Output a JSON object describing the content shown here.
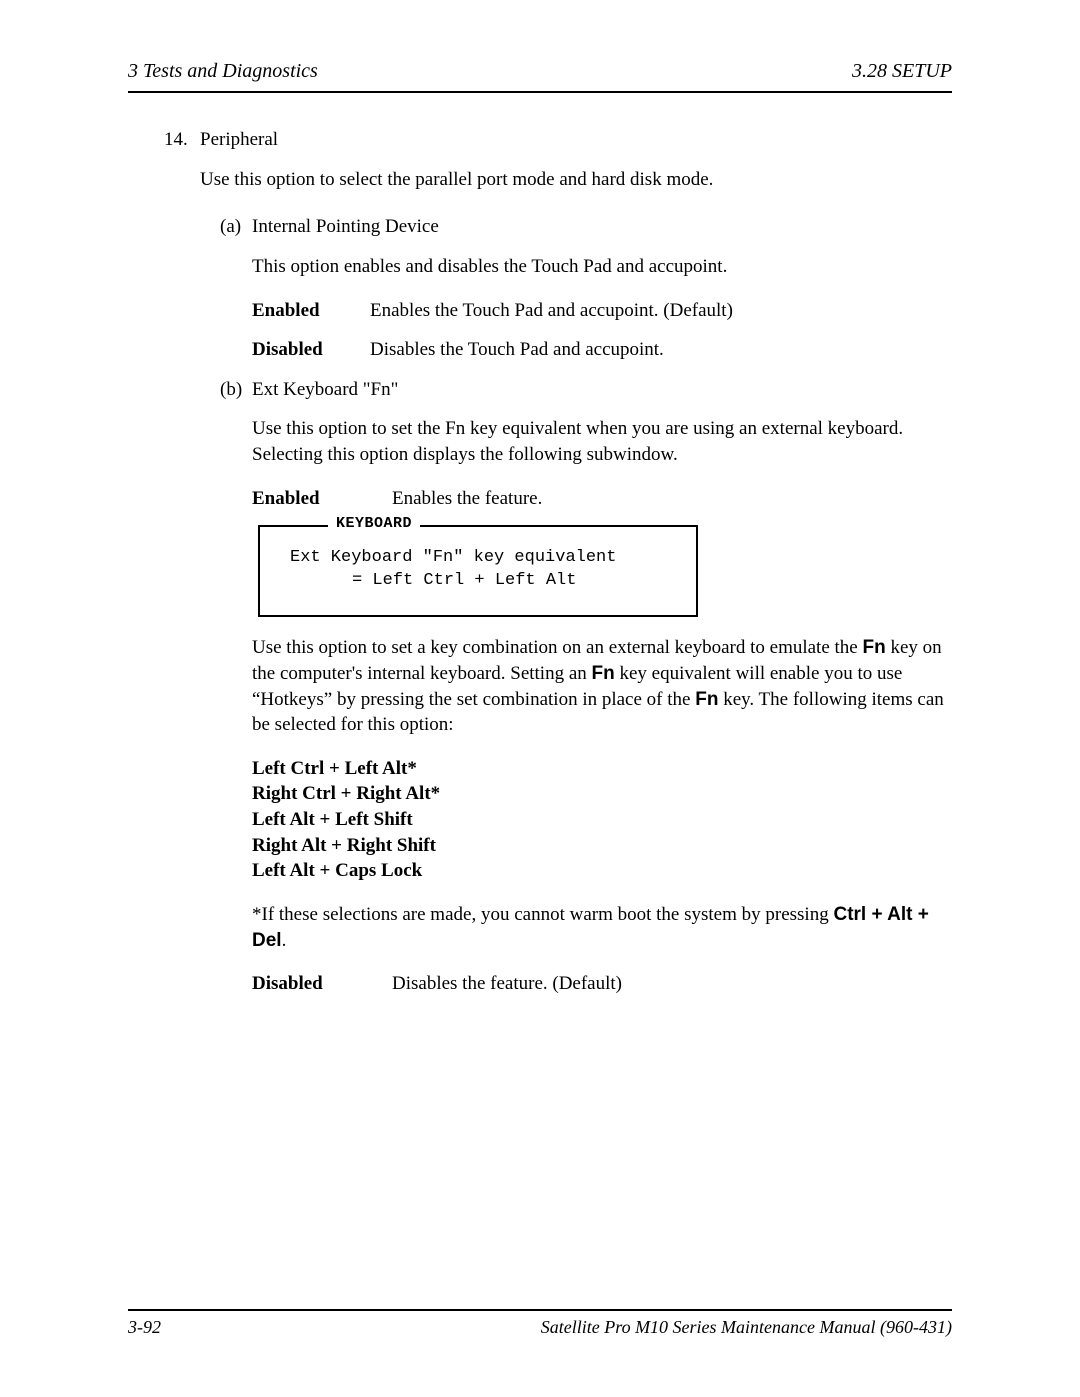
{
  "header": {
    "left": "3  Tests and Diagnostics",
    "right": "3.28  SETUP"
  },
  "section": {
    "number": "14.",
    "title": "Peripheral",
    "intro": "Use this option to select the parallel port mode and hard disk mode."
  },
  "subA": {
    "label": "(a)",
    "title": "Internal Pointing Device",
    "desc": "This option enables and disables the Touch Pad and accupoint.",
    "enabled_term": "Enabled",
    "enabled_desc": "Enables the Touch Pad and accupoint.  (Default)",
    "disabled_term": "Disabled",
    "disabled_desc": "Disables the Touch Pad and accupoint."
  },
  "subB": {
    "label": "(b)",
    "title": "Ext Keyboard \"Fn\"",
    "desc": "Use this option to set the Fn key equivalent when you are using an external keyboard. Selecting this option displays the following subwindow.",
    "enabled_term": "Enabled",
    "enabled_desc": "Enables the feature.",
    "box_title": "KEYBOARD",
    "box_line1": "Ext Keyboard \"Fn\" key equivalent",
    "box_line2": "= Left Ctrl + Left Alt",
    "para2_a": "Use this option to set a key combination on an external keyboard to emulate the ",
    "para2_fn1": "Fn",
    "para2_b": " key on the computer's internal keyboard. Setting an ",
    "para2_fn2": "Fn",
    "para2_c": " key equivalent will enable you to use “Hotkeys” by pressing the set combination in place of the ",
    "para2_fn3": "Fn",
    "para2_d": " key. The following items can be selected for this option:",
    "combos": [
      "Left Ctrl + Left Alt*",
      "Right Ctrl + Right Alt*",
      "Left Alt + Left Shift",
      "Right Alt + Right Shift",
      "Left Alt + Caps Lock"
    ],
    "note_a": "*If these selections are made, you cannot warm boot the system by pressing ",
    "note_b": "Ctrl + Alt + Del",
    "note_c": ".",
    "disabled_term": "Disabled",
    "disabled_desc": "Disables the feature. (Default)"
  },
  "footer": {
    "left": "3-92",
    "right": "Satellite Pro M10 Series Maintenance Manual (960-431)"
  }
}
